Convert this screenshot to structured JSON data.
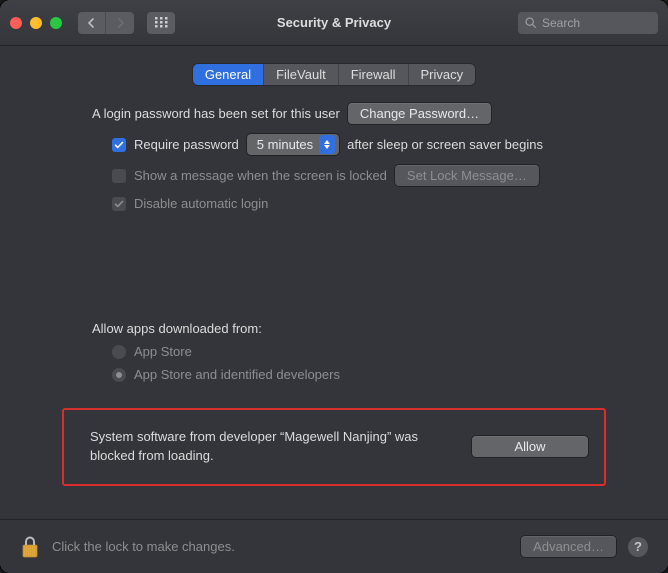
{
  "window": {
    "title": "Security & Privacy"
  },
  "search": {
    "placeholder": "Search"
  },
  "tabs": {
    "general": "General",
    "filevault": "FileVault",
    "firewall": "Firewall",
    "privacy": "Privacy"
  },
  "login": {
    "password_set": "A login password has been set for this user",
    "change_password": "Change Password…",
    "require_label_before": "Require password",
    "require_delay": "5 minutes",
    "require_label_after": "after sleep or screen saver begins",
    "show_message_label": "Show a message when the screen is locked",
    "set_lock_message": "Set Lock Message…",
    "disable_auto_login": "Disable automatic login"
  },
  "allow_apps": {
    "heading": "Allow apps downloaded from:",
    "opt1": "App Store",
    "opt2": "App Store and identified developers"
  },
  "blocked": {
    "message": "System software from developer “Magewell Nanjing” was blocked from loading.",
    "allow": "Allow"
  },
  "footer": {
    "lock_hint": "Click the lock to make changes.",
    "advanced": "Advanced…"
  }
}
